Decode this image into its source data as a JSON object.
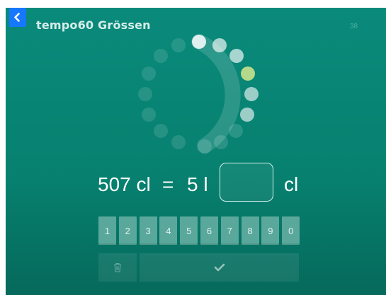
{
  "header": {
    "title": "tempo60 Grössen",
    "counter": "38",
    "back_icon": "chevron-left-icon"
  },
  "equation": {
    "left_value": "507 cl",
    "equals": "=",
    "middle_value": "5 l",
    "answer_value": "",
    "unit": "cl"
  },
  "keypad": {
    "keys": [
      "1",
      "2",
      "3",
      "4",
      "5",
      "6",
      "7",
      "8",
      "9",
      "0"
    ]
  },
  "actions": {
    "delete_icon": "trash-icon",
    "submit_icon": "checkmark-icon"
  },
  "colors": {
    "background": "#07806f",
    "accent_blue": "#1677ff",
    "highlight_dot": "#b5d98a"
  }
}
